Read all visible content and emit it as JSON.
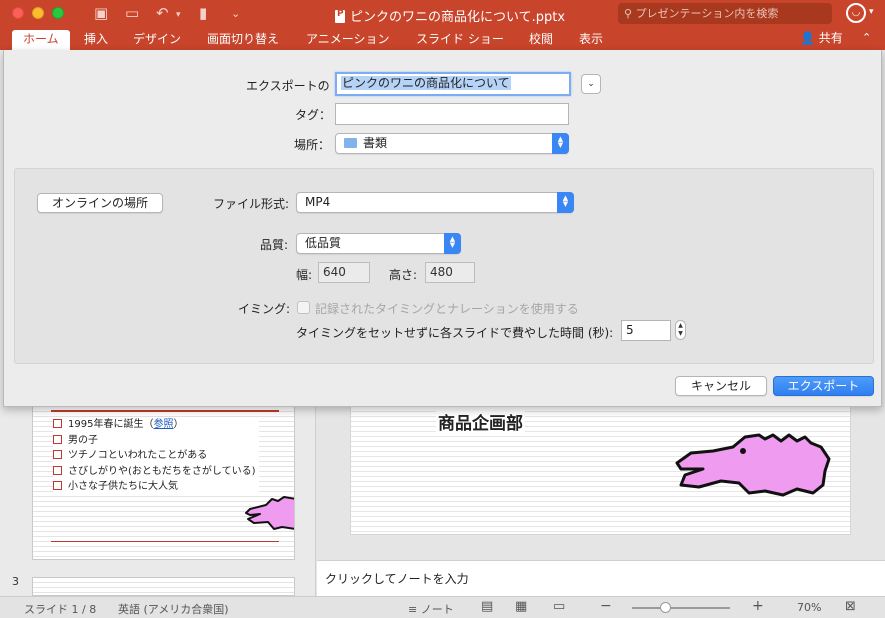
{
  "titlebar": {
    "document_title": "ピンクのワニの商品化について.pptx",
    "search_placeholder": "プレゼンテーション内を検索"
  },
  "ribbon": {
    "tabs": [
      "ホーム",
      "挿入",
      "デザイン",
      "画面切り替え",
      "アニメーション",
      "スライド ショー",
      "校閲",
      "表示"
    ],
    "active_tab": "ホーム",
    "share_label": "共有"
  },
  "export_dialog": {
    "export_as_label": "エクスポートの",
    "export_as_value": "ピンクのワニの商品化について",
    "tags_label": "タグ：",
    "tags_value": "",
    "location_label": "場所：",
    "location_value": "書類",
    "online_locations_button": "オンラインの場所",
    "file_format_label": "ファイル形式:",
    "file_format_value": "MP4",
    "quality_label": "品質:",
    "quality_value": "低品質",
    "width_label": "幅:",
    "width_value": "640",
    "height_label": "高さ:",
    "height_value": "480",
    "timing_label": "イミング:",
    "use_timings_checkbox_label": "記録されたタイミングとナレーションを使用する",
    "use_timings_checked": false,
    "seconds_per_slide_label": "タイミングをセットせずに各スライドで費やした時間 (秒):",
    "seconds_per_slide_value": "5",
    "cancel_button": "キャンセル",
    "export_button": "エクスポート"
  },
  "thumbnail_slide": {
    "bullets": [
      "1995年春に誕生（",
      "参照",
      "）",
      "男の子",
      "ツチノコといわれたことがある",
      "さびしがりや(おともだちをさがしている)",
      "小さな子供たちに大人気"
    ]
  },
  "slide_number_3": "3",
  "main_slide": {
    "heading": "商品企画部"
  },
  "notes_placeholder": "クリックしてノートを入力",
  "statusbar": {
    "slide_indicator": "スライド 1 / 8",
    "language": "英語 (アメリカ合衆国)",
    "notes_label": "ノート",
    "zoom_out": "−",
    "zoom_in": "+",
    "zoom_level": "70%"
  },
  "colors": {
    "accent": "#c8442b",
    "primary_button": "#2f7ff2",
    "crocodile_pink": "#ef9bf0"
  }
}
